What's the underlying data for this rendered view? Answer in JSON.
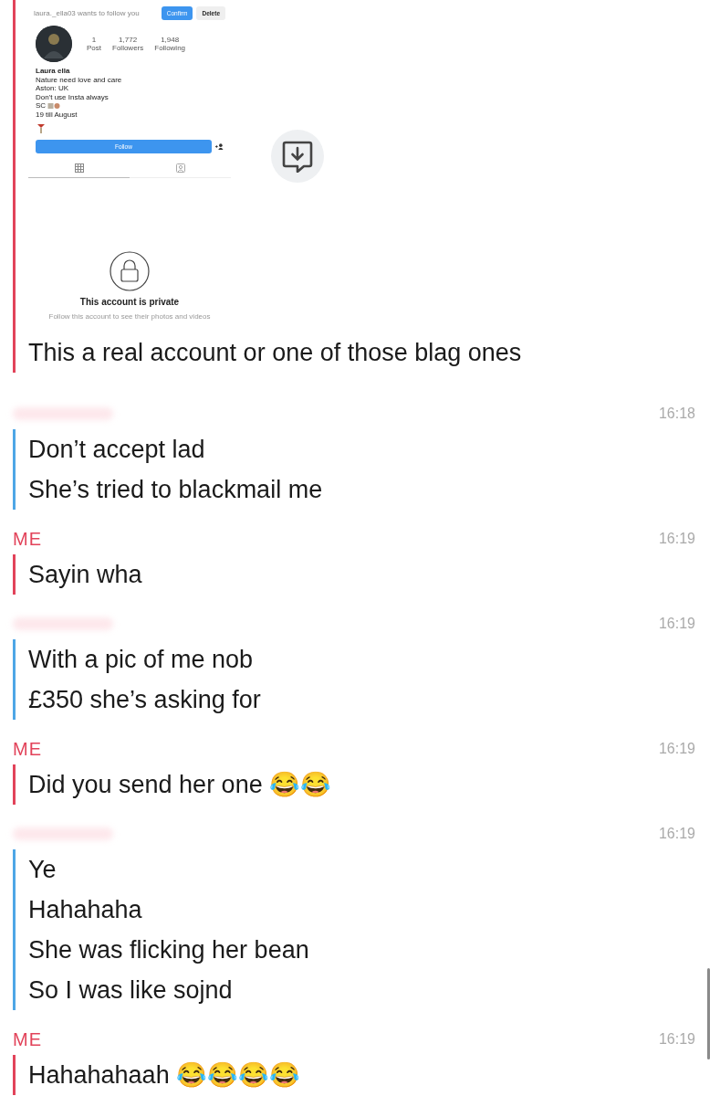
{
  "messages": [
    {
      "kind": "me",
      "attachment": {
        "request_text": "laura._ella03 wants to follow you",
        "confirm_label": "Confirm",
        "delete_label": "Delete",
        "stats": [
          {
            "value": "1",
            "label": "Post"
          },
          {
            "value": "1,772",
            "label": "Followers"
          },
          {
            "value": "1,948",
            "label": "Following"
          }
        ],
        "name": "Laura ella",
        "bio": [
          "Nature need love and care",
          "Aston: UK",
          "Don't use Insta always",
          "SC",
          "19 till August"
        ],
        "follow_label": "Follow",
        "private_title": "This account is private",
        "private_text": "Follow this account to see their photos and videos"
      },
      "lines": [
        "This a real account or one of those blag ones"
      ]
    },
    {
      "kind": "friend",
      "time": "16:18",
      "lines": [
        "Don’t accept lad",
        "She’s tried to blackmail me"
      ]
    },
    {
      "kind": "me",
      "sender": "ME",
      "time": "16:19",
      "lines": [
        "Sayin wha"
      ]
    },
    {
      "kind": "friend",
      "time": "16:19",
      "lines": [
        "With a pic of me nob",
        "£350 she’s asking for"
      ]
    },
    {
      "kind": "me",
      "sender": "ME",
      "time": "16:19",
      "lines": [
        "Did you send her one 😂😂"
      ]
    },
    {
      "kind": "friend",
      "time": "16:19",
      "lines": [
        "Ye",
        "Hahahaha",
        "She was flicking her bean",
        "So I was like sojnd"
      ]
    },
    {
      "kind": "me",
      "sender": "ME",
      "time": "16:19",
      "lines": [
        "Hahahahaah 😂😂😂😂"
      ]
    }
  ]
}
